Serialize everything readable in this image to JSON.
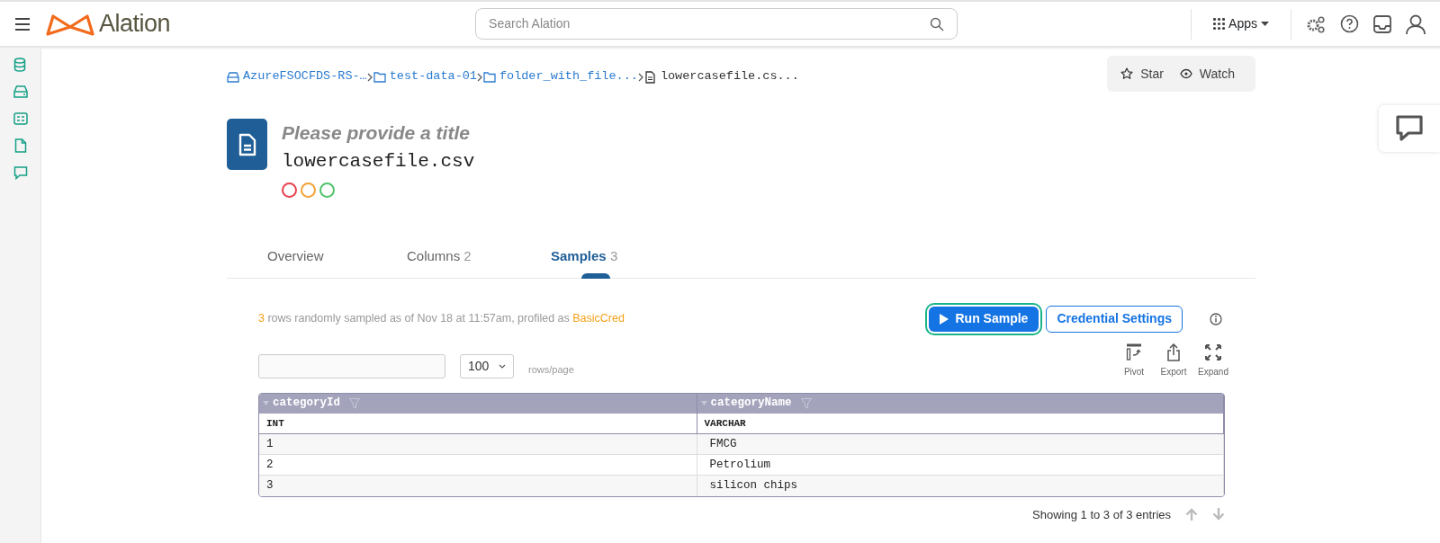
{
  "header": {
    "brand": "Alation",
    "search": {
      "placeholder": "Search Alation"
    },
    "apps": "Apps"
  },
  "breadcrumb": [
    {
      "label": "AzureFSOCFDS-RS-…",
      "kind": "storage",
      "current": false
    },
    {
      "label": "test-data-01",
      "kind": "folder",
      "current": false
    },
    {
      "label": "folder_with_file...",
      "kind": "folder",
      "current": false
    },
    {
      "label": "lowercasefile.cs...",
      "kind": "file",
      "current": true
    }
  ],
  "actions": [
    {
      "label": "Star",
      "kind": "star"
    },
    {
      "label": "Watch",
      "kind": "watch"
    }
  ],
  "object": {
    "title_placeholder": "Please provide a title",
    "name": "lowercasefile.csv",
    "flags": [
      {
        "color": "#e8414e"
      },
      {
        "color": "#f2a33a"
      },
      {
        "color": "#4fc36a"
      }
    ]
  },
  "tabs": [
    {
      "label": "Overview",
      "selected": false
    },
    {
      "label": "Columns",
      "count": "2",
      "selected": false
    },
    {
      "label": "Samples",
      "count": "3",
      "selected": true
    }
  ],
  "sample": {
    "row_count": "3",
    "text": " rows randomly sampled as of Nov 18 at 11:57am, profiled as ",
    "credential": "BasicCred"
  },
  "buttons": [
    {
      "label": "Run Sample",
      "kind": "run",
      "focused": true
    },
    {
      "label": "Credential Settings",
      "kind": "settings",
      "focused": false
    }
  ],
  "page_size": {
    "value": "100",
    "label": "rows/page"
  },
  "tools": [
    {
      "label": "Pivot",
      "kind": "pivot"
    },
    {
      "label": "Export",
      "kind": "export"
    },
    {
      "label": "Expand",
      "kind": "expand"
    }
  ],
  "table": {
    "columns": [
      {
        "name": "categoryId",
        "type": "INT"
      },
      {
        "name": "categoryName",
        "type": "VARCHAR"
      }
    ],
    "rows": [
      [
        "1",
        "FMCG"
      ],
      [
        "2",
        "Petrolium"
      ],
      [
        "3",
        "silicon chips"
      ]
    ]
  },
  "footer": "Showing 1 to 3 of 3 entries"
}
